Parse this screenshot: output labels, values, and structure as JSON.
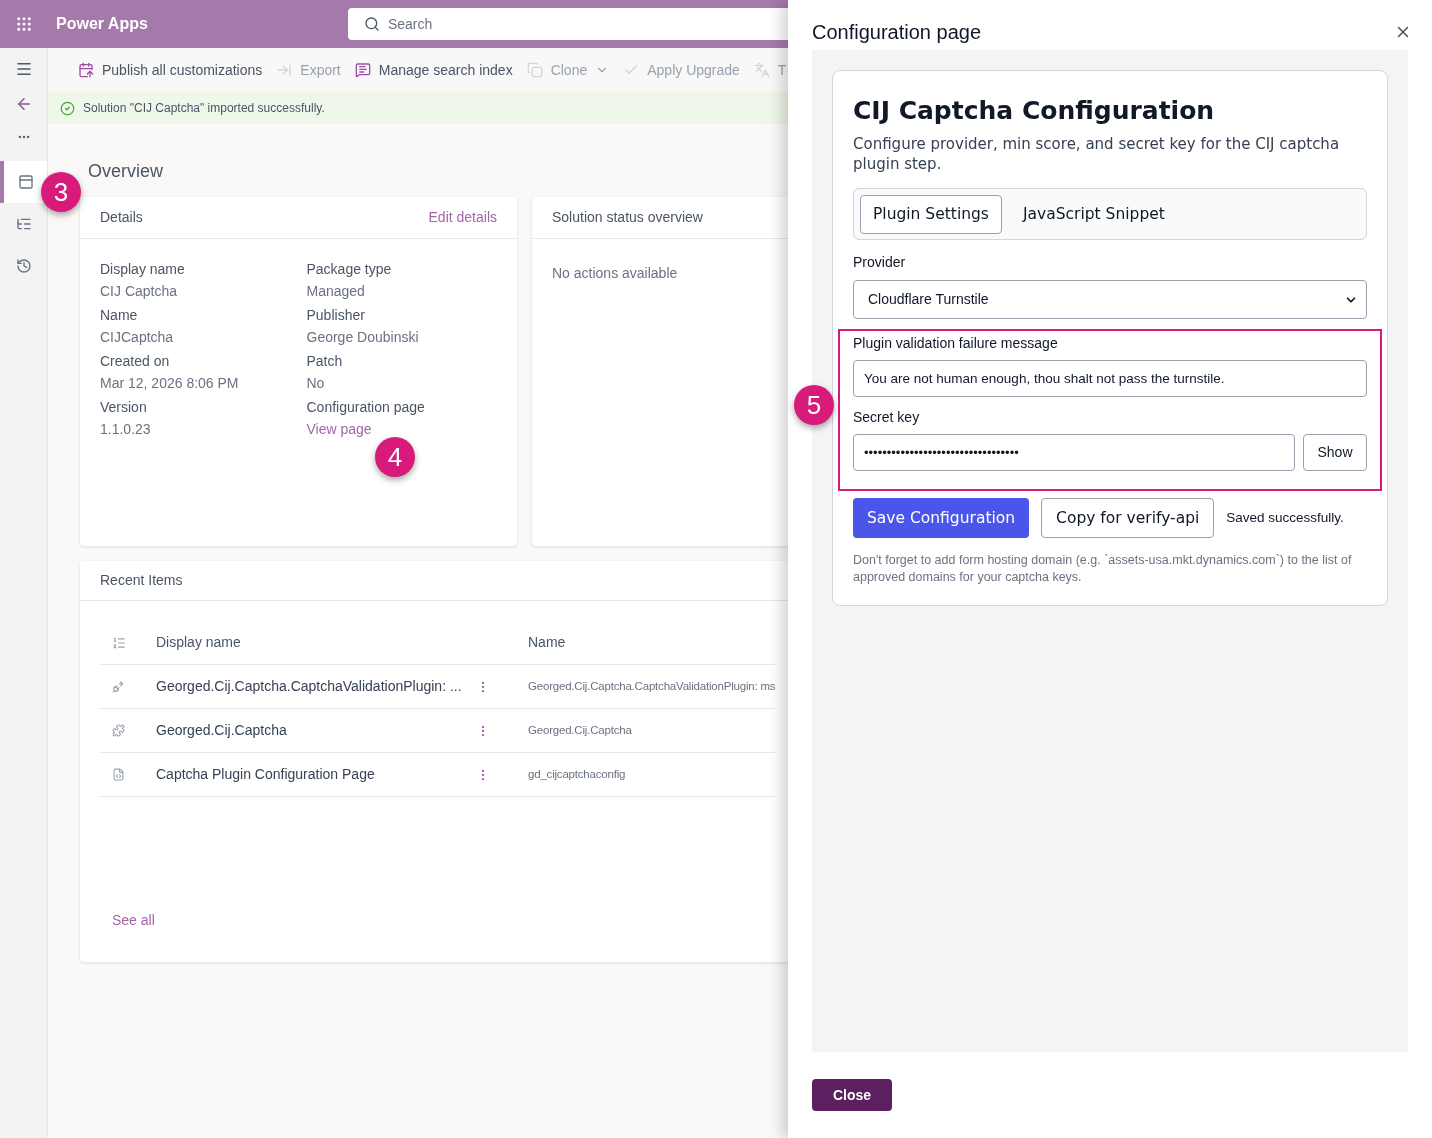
{
  "app_header": {
    "title": "Power Apps",
    "search": {
      "placeholder": "Search"
    }
  },
  "nav_rail": {
    "items": [
      {
        "kind": "solution",
        "selected": true
      },
      {
        "kind": "objects",
        "selected": false
      },
      {
        "kind": "history",
        "selected": false
      }
    ]
  },
  "command_bar": [
    {
      "kind": "publish",
      "label": "Publish all customizations",
      "disabled": false
    },
    {
      "kind": "export",
      "label": "Export",
      "disabled": true
    },
    {
      "kind": "search-index",
      "label": "Manage search index",
      "disabled": false
    },
    {
      "kind": "clone",
      "label": "Clone",
      "disabled": true
    },
    {
      "kind": "upgrade",
      "label": "Apply Upgrade",
      "disabled": true
    },
    {
      "kind": "translate",
      "label": "T",
      "disabled": true
    }
  ],
  "notification": {
    "text": "Solution \"CIJ Captcha\" imported successfully."
  },
  "overview": {
    "title": "Overview",
    "details": {
      "title": "Details",
      "edit_link": "Edit details",
      "fields": [
        {
          "label": "Display name",
          "value": "CIJ Captcha",
          "kind": "text"
        },
        {
          "label": "Package type",
          "value": "Managed",
          "kind": "text"
        },
        {
          "label": "Name",
          "value": "CIJCaptcha",
          "kind": "text"
        },
        {
          "label": "Publisher",
          "value": "George Doubinski",
          "kind": "text"
        },
        {
          "label": "Created on",
          "value": "Mar 12, 2026 8:06 PM",
          "kind": "text"
        },
        {
          "label": "Patch",
          "value": "No",
          "kind": "text"
        },
        {
          "label": "Version",
          "value": "1.1.0.23",
          "kind": "text"
        },
        {
          "label": "Configuration page",
          "value": "View page",
          "kind": "link"
        }
      ]
    },
    "status": {
      "title": "Solution status overview",
      "text": "No actions available"
    }
  },
  "recent_items": {
    "title": "Recent Items",
    "columns": [
      "Display name",
      "Name"
    ],
    "rows": [
      {
        "kind": "plugin-step",
        "display_name": "Georged.Cij.Captcha.CaptchaValidationPlugin: ...",
        "name": "Georged.Cij.Captcha.CaptchaValidationPlugin: ms"
      },
      {
        "kind": "plugin",
        "display_name": "Georged.Cij.Captcha",
        "name": "Georged.Cij.Captcha"
      },
      {
        "kind": "web-resource",
        "display_name": "Captcha Plugin Configuration Page",
        "name": "gd_cijcaptchaconfig"
      }
    ],
    "see_all": "See all"
  },
  "config_panel": {
    "title": "Configuration page",
    "heading": "CIJ Captcha Configuration",
    "description": "Configure provider, min score, and secret key for the CIJ captcha plugin step.",
    "tabs": [
      {
        "label": "Plugin Settings",
        "selected": true
      },
      {
        "label": "JavaScript Snippet",
        "selected": false
      }
    ],
    "provider": {
      "label": "Provider",
      "value": "Cloudflare Turnstile"
    },
    "failure_message": {
      "label": "Plugin validation failure message",
      "value": "You are not human enough, thou shalt not pass the turnstile."
    },
    "secret_key": {
      "label": "Secret key",
      "value": "••••••••••••••••••••••••••••••••••",
      "button": "Show"
    },
    "buttons": [
      {
        "kind": "primary",
        "label": "Save Configuration"
      },
      {
        "kind": "secondary",
        "label": "Copy for verify-api"
      }
    ],
    "status": "Saved successfully.",
    "note": "Don't forget to add form hosting domain (e.g. `assets-usa.mkt.dynamics.com`) to the list of approved domains for your captcha keys.",
    "close_button": "Close"
  },
  "annotations": [
    {
      "label": "3"
    },
    {
      "label": "4"
    },
    {
      "label": "5"
    }
  ]
}
